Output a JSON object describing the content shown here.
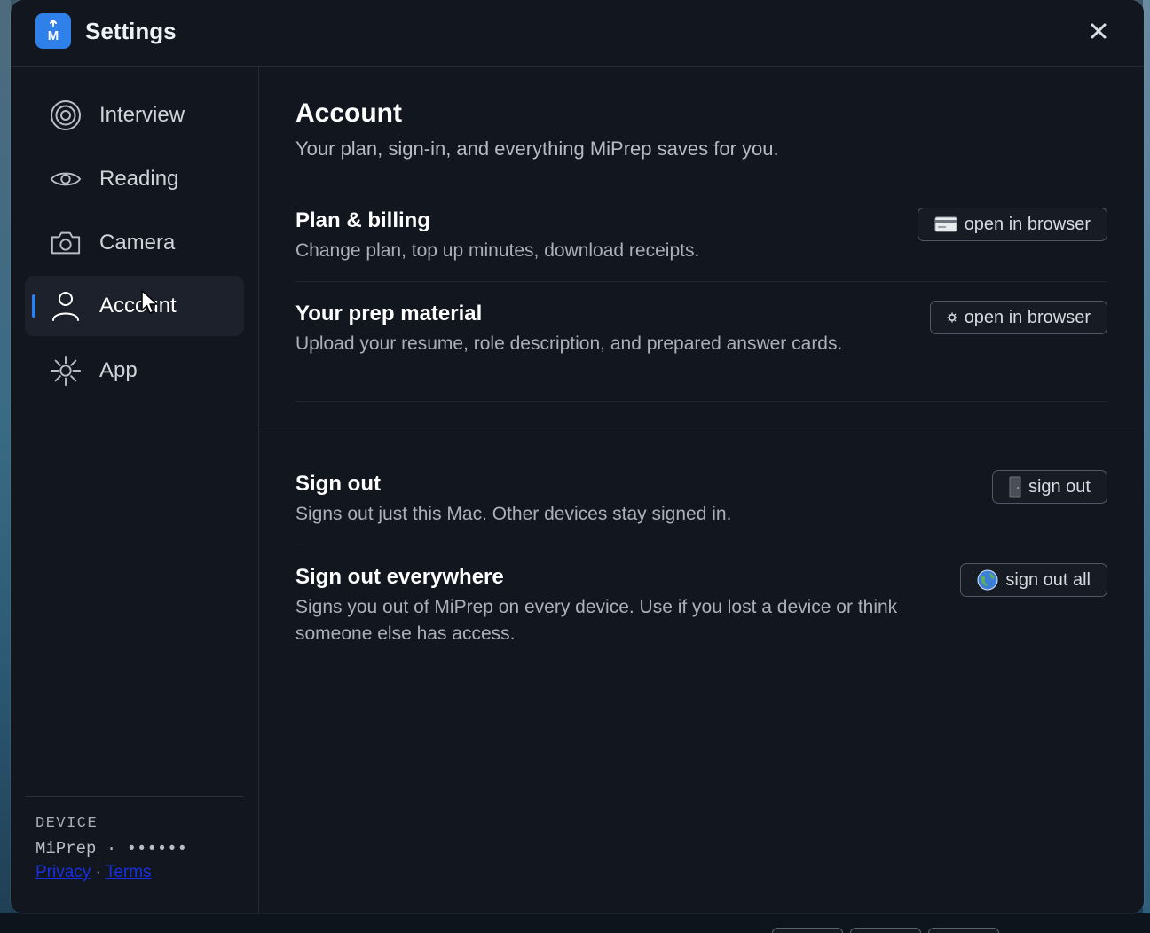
{
  "window": {
    "title": "Settings",
    "logo_letter": "M"
  },
  "sidebar": {
    "items": [
      {
        "label": "Interview",
        "icon": "target-icon",
        "active": false
      },
      {
        "label": "Reading",
        "icon": "eye-icon",
        "active": false
      },
      {
        "label": "Camera",
        "icon": "camera-icon",
        "active": false
      },
      {
        "label": "Account",
        "icon": "person-icon",
        "active": true
      },
      {
        "label": "App",
        "icon": "sun-icon",
        "active": false
      }
    ],
    "device": {
      "heading": "DEVICE",
      "name": "MiPrep",
      "separator": "·",
      "masked_id": "••••••",
      "privacy_label": "Privacy",
      "links_separator": "·",
      "terms_label": "Terms"
    }
  },
  "main": {
    "title": "Account",
    "subtitle": "Your plan, sign-in, and everything MiPrep saves for you.",
    "rows": [
      {
        "title": "Plan & billing",
        "description": "Change plan, top up minutes, download receipts.",
        "button_label": "open in browser",
        "button_icon": "credit-card-icon"
      },
      {
        "title": "Your prep material",
        "description": "Upload your resume, role description, and prepared answer cards.",
        "button_label": "open in browser",
        "button_icon": "gear-icon"
      },
      {
        "title": "Sign out",
        "description": "Signs out just this Mac. Other devices stay signed in.",
        "button_label": "sign out",
        "button_icon": "door-icon"
      },
      {
        "title": "Sign out everywhere",
        "description": "Signs you out of MiPrep on every device. Use if you lost a device or think someone else has access.",
        "button_label": "sign out all",
        "button_icon": "globe-icon"
      }
    ]
  },
  "colors": {
    "accent": "#2f80e8",
    "window_bg": "#12161f",
    "link": "#1a2fe0"
  }
}
